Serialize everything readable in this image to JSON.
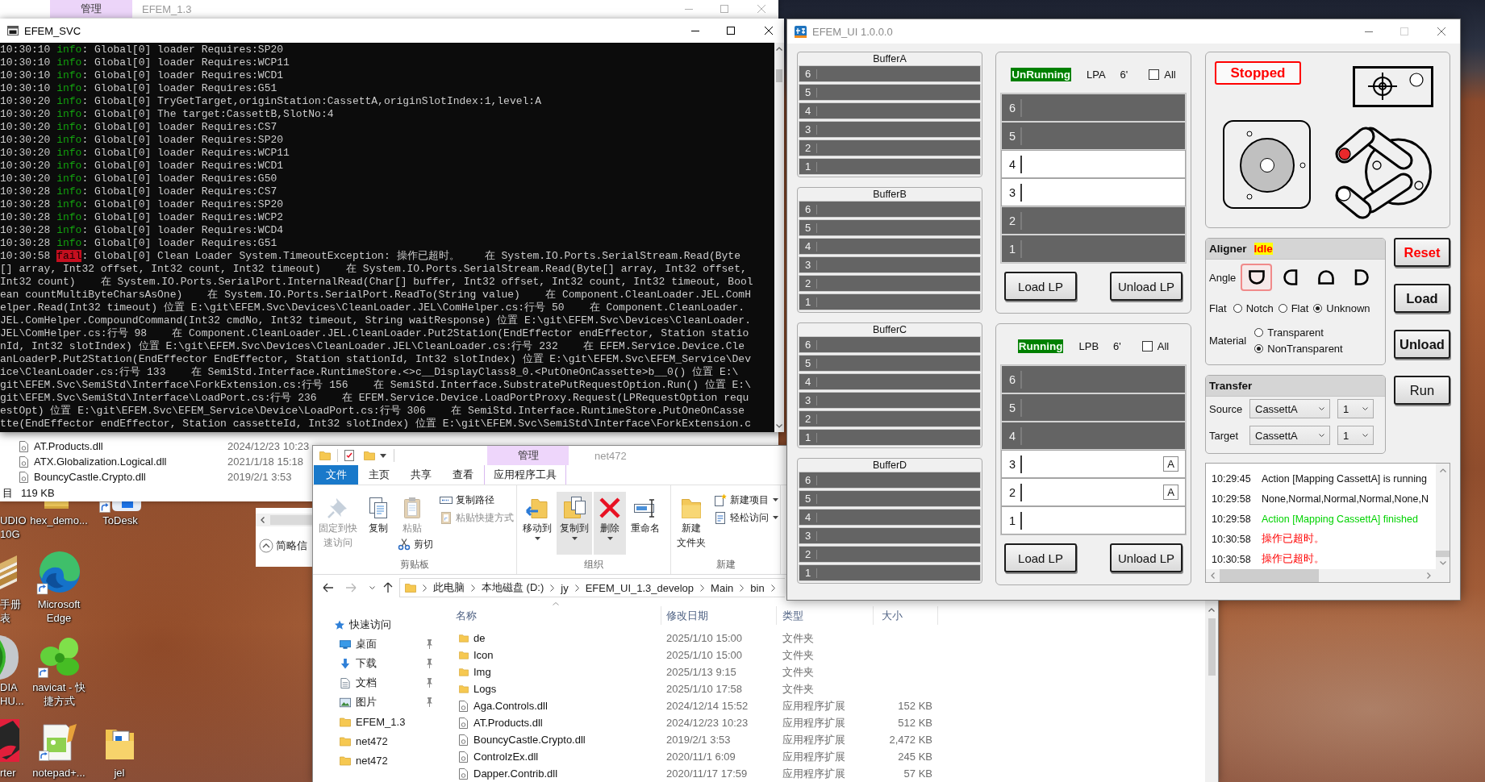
{
  "desktop_icons": [
    {
      "lines": [
        "UDIO",
        "10G"
      ]
    },
    {
      "lines": [
        "hex_demo..."
      ]
    },
    {
      "lines": [
        "ToDesk"
      ]
    },
    {
      "lines": [
        "手册",
        "表"
      ]
    },
    {
      "lines": [
        "Microsoft",
        "Edge"
      ]
    },
    {
      "lines": [
        "DIA",
        "HU..."
      ]
    },
    {
      "lines": [
        "navicat - 快",
        "捷方式"
      ]
    },
    {
      "lines": [
        "rter"
      ]
    },
    {
      "lines": [
        "notepad+..."
      ]
    },
    {
      "lines": [
        "jel"
      ]
    }
  ],
  "back_window": {
    "context_tab": "管理",
    "title": "EFEM_1.3",
    "files": [
      {
        "name": "AT.Products.dll",
        "date": "2024/12/23 10:23"
      },
      {
        "name": "ATX.Globalization.Logical.dll",
        "date": "2021/1/18 15:18"
      },
      {
        "name": "BouncyCastle.Crypto.dll",
        "date": "2019/2/1 3:53"
      }
    ],
    "status": "目",
    "status_size": "119 KB"
  },
  "copy_dialog": {
    "button": "简略信"
  },
  "console": {
    "title": "EFEM_SVC",
    "lines": [
      {
        "time": "10:30:10",
        "level": "info",
        "kind": "info",
        "message": ": Global[0] loader Requires:SP20"
      },
      {
        "time": "10:30:10",
        "level": "info",
        "kind": "info",
        "message": ": Global[0] loader Requires:WCP11"
      },
      {
        "time": "10:30:10",
        "level": "info",
        "kind": "info",
        "message": ": Global[0] loader Requires:WCD1"
      },
      {
        "time": "10:30:10",
        "level": "info",
        "kind": "info",
        "message": ": Global[0] loader Requires:G51"
      },
      {
        "time": "10:30:20",
        "level": "info",
        "kind": "info",
        "message": ": Global[0] TryGetTarget,originStation:CassettA,originSlotIndex:1,level:A"
      },
      {
        "time": "10:30:20",
        "level": "info",
        "kind": "info",
        "message": ": Global[0] The target:CassettB,SlotNo:4"
      },
      {
        "time": "10:30:20",
        "level": "info",
        "kind": "info",
        "message": ": Global[0] loader Requires:CS7"
      },
      {
        "time": "10:30:20",
        "level": "info",
        "kind": "info",
        "message": ": Global[0] loader Requires:SP20"
      },
      {
        "time": "10:30:20",
        "level": "info",
        "kind": "info",
        "message": ": Global[0] loader Requires:WCP11"
      },
      {
        "time": "10:30:20",
        "level": "info",
        "kind": "info",
        "message": ": Global[0] loader Requires:WCD1"
      },
      {
        "time": "10:30:20",
        "level": "info",
        "kind": "info",
        "message": ": Global[0] loader Requires:G50"
      },
      {
        "time": "10:30:28",
        "level": "info",
        "kind": "info",
        "message": ": Global[0] loader Requires:CS7"
      },
      {
        "time": "10:30:28",
        "level": "info",
        "kind": "info",
        "message": ": Global[0] loader Requires:SP20"
      },
      {
        "time": "10:30:28",
        "level": "info",
        "kind": "info",
        "message": ": Global[0] loader Requires:WCP2"
      },
      {
        "time": "10:30:28",
        "level": "info",
        "kind": "info",
        "message": ": Global[0] loader Requires:WCD4"
      },
      {
        "time": "10:30:28",
        "level": "info",
        "kind": "info",
        "message": ": Global[0] loader Requires:G51"
      },
      {
        "time": "10:30:58",
        "level": "fail",
        "kind": "fail",
        "message": ": Global[0] Clean Loader System.TimeoutException: 操作已超时。    在 System.IO.Ports.SerialStream.Read(Byte"
      },
      {
        "text": "[] array, Int32 offset, Int32 count, Int32 timeout)    在 System.IO.Ports.SerialStream.Read(Byte[] array, Int32 offset,"
      },
      {
        "text": "Int32 count)    在 System.IO.Ports.SerialPort.InternalRead(Char[] buffer, Int32 offset, Int32 count, Int32 timeout, Bool"
      },
      {
        "text": "ean countMultiByteCharsAsOne)    在 System.IO.Ports.SerialPort.ReadTo(String value)    在 Component.CleanLoader.JEL.ComH"
      },
      {
        "text": "elper.Read(Int32 timeout) 位置 E:\\git\\EFEM.Svc\\Devices\\CleanLoader.JEL\\ComHelper.cs:行号 50    在 Component.CleanLoader."
      },
      {
        "text": "JEL.ComHelper.CompoundCommand(Int32 cmdNo, Int32 timeout, String waitResponse) 位置 E:\\git\\EFEM.Svc\\Devices\\CleanLoader."
      },
      {
        "text": "JEL\\ComHelper.cs:行号 98    在 Component.CleanLoader.JEL.CleanLoader.Put2Station(EndEffector endEffector, Station statio"
      },
      {
        "text": "nId, Int32 slotIndex) 位置 E:\\git\\EFEM.Svc\\Devices\\CleanLoader.JEL\\CleanLoader.cs:行号 232    在 EFEM.Service.Device.Cle"
      },
      {
        "text": "anLoaderP.Put2Station(EndEffector EndEffector, Station stationId, Int32 slotIndex) 位置 E:\\git\\EFEM.Svc\\EFEM_Service\\Dev"
      },
      {
        "text": "ice\\CleanLoader.cs:行号 133    在 SemiStd.Interface.RuntimeStore.<>c__DisplayClass8_0.<PutOneOnCassette>b__0() 位置 E:\\"
      },
      {
        "text": "git\\EFEM.Svc\\SemiStd\\Interface\\ForkExtension.cs:行号 156    在 SemiStd.Interface.SubstratePutRequestOption.Run() 位置 E:\\"
      },
      {
        "text": "git\\EFEM.Svc\\SemiStd\\Interface\\LoadPort.cs:行号 236    在 EFEM.Service.Device.LoadPortProxy.Request(LPRequestOption requ"
      },
      {
        "text": "estOpt) 位置 E:\\git\\EFEM.Svc\\EFEM_Service\\Device\\LoadPort.cs:行号 306    在 SemiStd.Interface.RuntimeStore.PutOneOnCasse"
      },
      {
        "text": "tte(EndEffector endEffector, Station cassetteId, Int32 slotIndex) 位置 E:\\git\\EFEM.Svc\\SemiStd\\Interface\\ForkExtension.c"
      }
    ]
  },
  "explorer": {
    "context_tab": "管理",
    "title": "net472",
    "tabs": [
      {
        "label": "文件",
        "kind": "file"
      },
      {
        "label": "主页",
        "kind": "plain"
      },
      {
        "label": "共享",
        "kind": "plain"
      },
      {
        "label": "查看",
        "kind": "plain"
      },
      {
        "label": "应用程序工具",
        "kind": "context"
      }
    ],
    "groups": [
      {
        "label": "剪贴板",
        "columns": [
          [
            {
              "kind": "large",
              "lines": [
                "固定到快",
                "速访问"
              ],
              "disabled": true,
              "menu": false,
              "highlighted": false
            }
          ],
          [
            {
              "kind": "large",
              "lines": [
                "复制"
              ],
              "disabled": false,
              "menu": false,
              "highlighted": false
            }
          ],
          [
            {
              "kind": "large",
              "lines": [
                "粘贴"
              ],
              "disabled": true,
              "menu": false,
              "highlighted": false
            },
            {
              "kind": "small",
              "lines": [
                "剪切"
              ],
              "disabled": false,
              "menu": false,
              "highlighted": false
            }
          ],
          [
            {
              "kind": "small",
              "lines": [
                "复制路径"
              ],
              "disabled": false,
              "menu": false,
              "highlighted": false
            },
            {
              "kind": "small",
              "lines": [
                "粘贴快捷方式"
              ],
              "disabled": true,
              "menu": false,
              "highlighted": false
            }
          ]
        ]
      },
      {
        "label": "组织",
        "columns": [
          [
            {
              "kind": "large",
              "lines": [
                "移动到"
              ],
              "disabled": false,
              "menu": true,
              "highlighted": false
            }
          ],
          [
            {
              "kind": "large",
              "lines": [
                "复制到"
              ],
              "disabled": false,
              "menu": true,
              "highlighted": true
            }
          ],
          [
            {
              "kind": "large",
              "lines": [
                "删除"
              ],
              "disabled": false,
              "menu": true,
              "highlighted": true
            }
          ],
          [
            {
              "kind": "large",
              "lines": [
                "重命名"
              ],
              "disabled": false,
              "menu": false,
              "highlighted": false
            }
          ]
        ]
      },
      {
        "label": "新建",
        "columns": [
          [
            {
              "kind": "large",
              "lines": [
                "新建",
                "文件夹"
              ],
              "disabled": false,
              "menu": false,
              "highlighted": false
            }
          ],
          [
            {
              "kind": "small",
              "lines": [
                "新建项目"
              ],
              "disabled": false,
              "menu": true,
              "highlighted": false
            },
            {
              "kind": "small",
              "lines": [
                "轻松访问"
              ],
              "disabled": false,
              "menu": true,
              "highlighted": false
            }
          ]
        ]
      }
    ],
    "forward_disabled": true,
    "breadcrumbs": [
      "此电脑",
      "本地磁盘 (D:)",
      "jy",
      "EFEM_UI_1.3_develop",
      "Main",
      "bin"
    ],
    "nav": [
      {
        "label": "快速访问",
        "kind": "quick_access",
        "children": [
          {
            "label": "桌面",
            "kind": "desktop",
            "pinned": true
          },
          {
            "label": "下载",
            "kind": "downloads",
            "pinned": true
          },
          {
            "label": "文档",
            "kind": "documents",
            "pinned": true
          },
          {
            "label": "图片",
            "kind": "pictures",
            "pinned": true
          },
          {
            "label": "EFEM_1.3",
            "kind": "folder",
            "pinned": false
          },
          {
            "label": "net472",
            "kind": "folder",
            "pinned": false
          },
          {
            "label": "net472",
            "kind": "folder",
            "pinned": false
          }
        ]
      }
    ],
    "columns": [
      "名称",
      "修改日期",
      "类型",
      "大小"
    ],
    "files": [
      {
        "name": "de",
        "kind": "folder",
        "date": "2025/1/10 15:00",
        "type": "文件夹"
      },
      {
        "name": "Icon",
        "kind": "folder",
        "date": "2025/1/10 15:00",
        "type": "文件夹"
      },
      {
        "name": "Img",
        "kind": "folder",
        "date": "2025/1/13 9:15",
        "type": "文件夹"
      },
      {
        "name": "Logs",
        "kind": "folder",
        "date": "2025/1/10 17:58",
        "type": "文件夹"
      },
      {
        "name": "Aga.Controls.dll",
        "kind": "file",
        "date": "2024/12/14 15:52",
        "type": "应用程序扩展",
        "size": "152 KB"
      },
      {
        "name": "AT.Products.dll",
        "kind": "file",
        "date": "2024/12/23 10:23",
        "type": "应用程序扩展",
        "size": "512 KB"
      },
      {
        "name": "BouncyCastle.Crypto.dll",
        "kind": "file",
        "date": "2019/2/1 3:53",
        "type": "应用程序扩展",
        "size": "2,472 KB"
      },
      {
        "name": "ControlzEx.dll",
        "kind": "file",
        "date": "2020/11/1 6:09",
        "type": "应用程序扩展",
        "size": "245 KB"
      },
      {
        "name": "Dapper.Contrib.dll",
        "kind": "file",
        "date": "2020/11/17 17:59",
        "type": "应用程序扩展",
        "size": "57 KB"
      }
    ]
  },
  "efem_ui": {
    "title": "EFEM_UI 1.0.0.0",
    "maximize_disabled": true,
    "buffers": [
      {
        "title": "BufferA",
        "slots": [
          {
            "label": "6",
            "shaded": true
          },
          {
            "label": "5",
            "shaded": true
          },
          {
            "label": "4",
            "shaded": true
          },
          {
            "label": "3",
            "shaded": true
          },
          {
            "label": "2",
            "shaded": true
          },
          {
            "label": "1",
            "shaded": true
          }
        ]
      },
      {
        "title": "BufferB",
        "slots": [
          {
            "label": "6",
            "shaded": true
          },
          {
            "label": "5",
            "shaded": true
          },
          {
            "label": "4",
            "shaded": true
          },
          {
            "label": "3",
            "shaded": true
          },
          {
            "label": "2",
            "shaded": true
          },
          {
            "label": "1",
            "shaded": true
          }
        ]
      },
      {
        "title": "BufferC",
        "slots": [
          {
            "label": "6",
            "shaded": true
          },
          {
            "label": "5",
            "shaded": true
          },
          {
            "label": "4",
            "shaded": true
          },
          {
            "label": "3",
            "shaded": true
          },
          {
            "label": "2",
            "shaded": true
          },
          {
            "label": "1",
            "shaded": true
          }
        ]
      },
      {
        "title": "BufferD",
        "slots": [
          {
            "label": "6",
            "shaded": true
          },
          {
            "label": "5",
            "shaded": true
          },
          {
            "label": "4",
            "shaded": true
          },
          {
            "label": "3",
            "shaded": true
          },
          {
            "label": "2",
            "shaded": true
          },
          {
            "label": "1",
            "shaded": true
          }
        ]
      }
    ],
    "load_ports": [
      {
        "status": "UnRunning",
        "name": "LPA",
        "size": "6'",
        "all": {
          "label": "All",
          "checked": false
        },
        "slots": [
          {
            "label": "6",
            "shaded": true
          },
          {
            "label": "5",
            "shaded": true
          },
          {
            "label": "4",
            "shaded": false
          },
          {
            "label": "3",
            "shaded": false
          },
          {
            "label": "2",
            "shaded": true
          },
          {
            "label": "1",
            "shaded": true
          }
        ],
        "buttons": [
          "Load LP",
          "Unload LP"
        ]
      },
      {
        "status": "Running",
        "name": "LPB",
        "size": "6'",
        "all": {
          "label": "All",
          "checked": false
        },
        "slots": [
          {
            "label": "6",
            "shaded": true
          },
          {
            "label": "5",
            "shaded": true
          },
          {
            "label": "4",
            "shaded": true
          },
          {
            "label": "3",
            "shaded": false,
            "tag": "A"
          },
          {
            "label": "2",
            "shaded": false,
            "tag": "A"
          },
          {
            "label": "1",
            "shaded": false
          }
        ],
        "buttons": [
          "Load LP",
          "Unload LP"
        ]
      }
    ],
    "machine_status": "Stopped",
    "aligner": {
      "title": "Aligner",
      "status": "Idle",
      "angle_label": "Angle",
      "angles": [
        {
          "kind": "flat_top",
          "selected": true
        },
        {
          "kind": "flat_right",
          "selected": false
        },
        {
          "kind": "flat_bottom",
          "selected": false
        },
        {
          "kind": "flat_left",
          "selected": false
        }
      ],
      "flat_label": "Flat",
      "flat_options": [
        {
          "label": "Notch",
          "selected": false
        },
        {
          "label": "Flat",
          "selected": false
        },
        {
          "label": "Unknown",
          "selected": true
        }
      ],
      "material_label": "Material",
      "material_options": [
        {
          "label": "Transparent",
          "selected": false
        },
        {
          "label": "NonTransparent",
          "selected": true
        }
      ]
    },
    "transfer": {
      "title": "Transfer",
      "rows": [
        {
          "label": "Source",
          "station": "CassettA",
          "slot": "1"
        },
        {
          "label": "Target",
          "station": "CassettA",
          "slot": "1"
        }
      ]
    },
    "actions": [
      {
        "label": "Reset",
        "kind": "danger"
      },
      {
        "label": "Load",
        "kind": "strong"
      },
      {
        "label": "Unload",
        "kind": "strong"
      },
      {
        "label": "Run",
        "kind": "plain"
      }
    ],
    "log": [
      {
        "time": "10:29:45",
        "message": "Action [Mapping CassettA] is running",
        "kind": "info"
      },
      {
        "time": "10:29:58",
        "message": "None,Normal,Normal,Normal,None,N",
        "kind": "info"
      },
      {
        "time": "10:29:58",
        "message": "Action [Mapping CassettA] finished",
        "kind": "success"
      },
      {
        "time": "10:30:58",
        "message": "操作已超时。",
        "kind": "error"
      },
      {
        "time": "10:30:58",
        "message": "操作已超时。",
        "kind": "error"
      }
    ]
  }
}
